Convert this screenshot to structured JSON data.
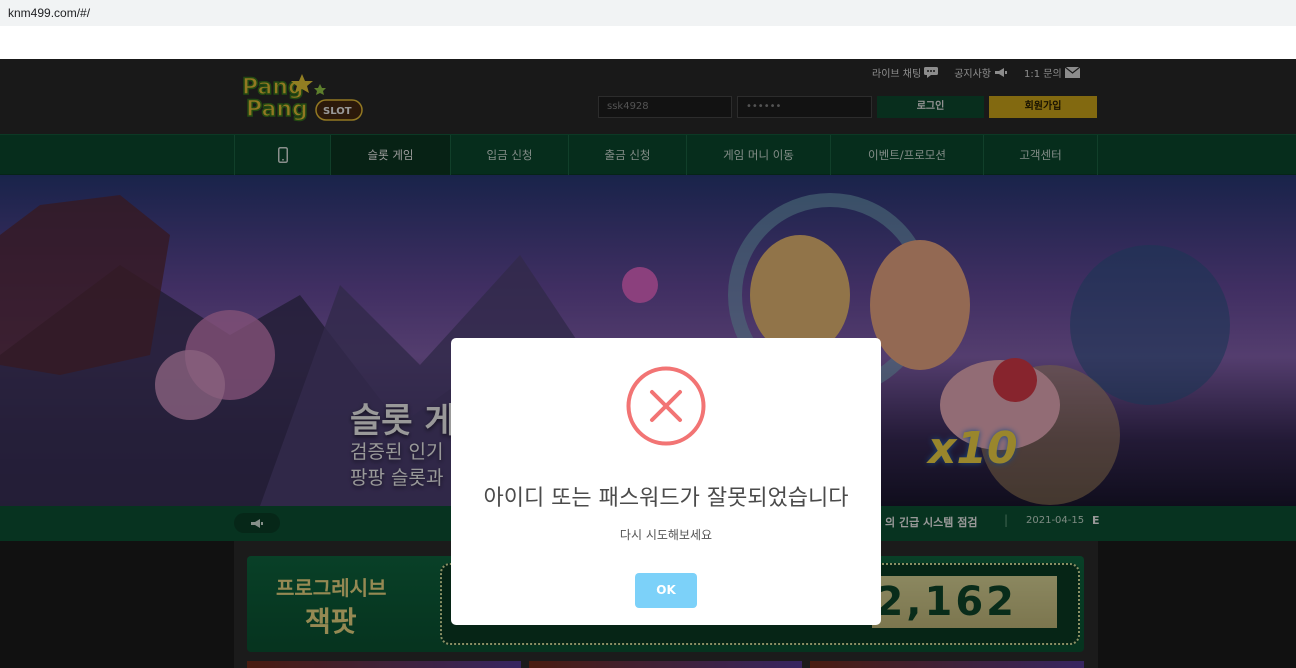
{
  "browser": {
    "url": "knm499.com/#/"
  },
  "header": {
    "logo": {
      "line1": "Pang",
      "line2": "Pang",
      "badge": "SLOT"
    },
    "top_links": [
      {
        "label": "라이브 채팅",
        "icon": "chat-icon"
      },
      {
        "label": "공지사항",
        "icon": "megaphone-icon"
      },
      {
        "label": "1:1 문의",
        "icon": "mail-icon"
      }
    ],
    "login": {
      "username_value": "ssk4928",
      "password_value": "••••••",
      "login_label": "로그인",
      "signup_label": "회원가입"
    }
  },
  "nav": {
    "items": [
      {
        "label": "",
        "icon": "mobile-icon"
      },
      {
        "label": "슬롯 게임",
        "active": true
      },
      {
        "label": "입금 신청"
      },
      {
        "label": "출금 신청"
      },
      {
        "label": "게임 머니 이동"
      },
      {
        "label": "이벤트/프로모션"
      },
      {
        "label": "고객센터"
      }
    ]
  },
  "banner": {
    "line1": "슬롯 게",
    "line2": "검증된 인기",
    "line3": "팡팡 슬롯과",
    "multiplier": "x10"
  },
  "ticker": {
    "text": "의 긴급 시스템 점검",
    "separator": "|",
    "date": "2021-04-15",
    "trailing": "E"
  },
  "jackpot": {
    "title_line1": "프로그레시브",
    "title_line2": "잭팟",
    "value": "2,162"
  },
  "dialog": {
    "title": "아이디 또는 패스워드가 잘못되었습니다",
    "message": "다시 시도해보세요",
    "ok_label": "OK"
  },
  "colors": {
    "nav_green": "#0b4b30",
    "signup_gold": "#d9b01c",
    "error_red": "#f27474",
    "ok_blue": "#7cd1f9"
  }
}
